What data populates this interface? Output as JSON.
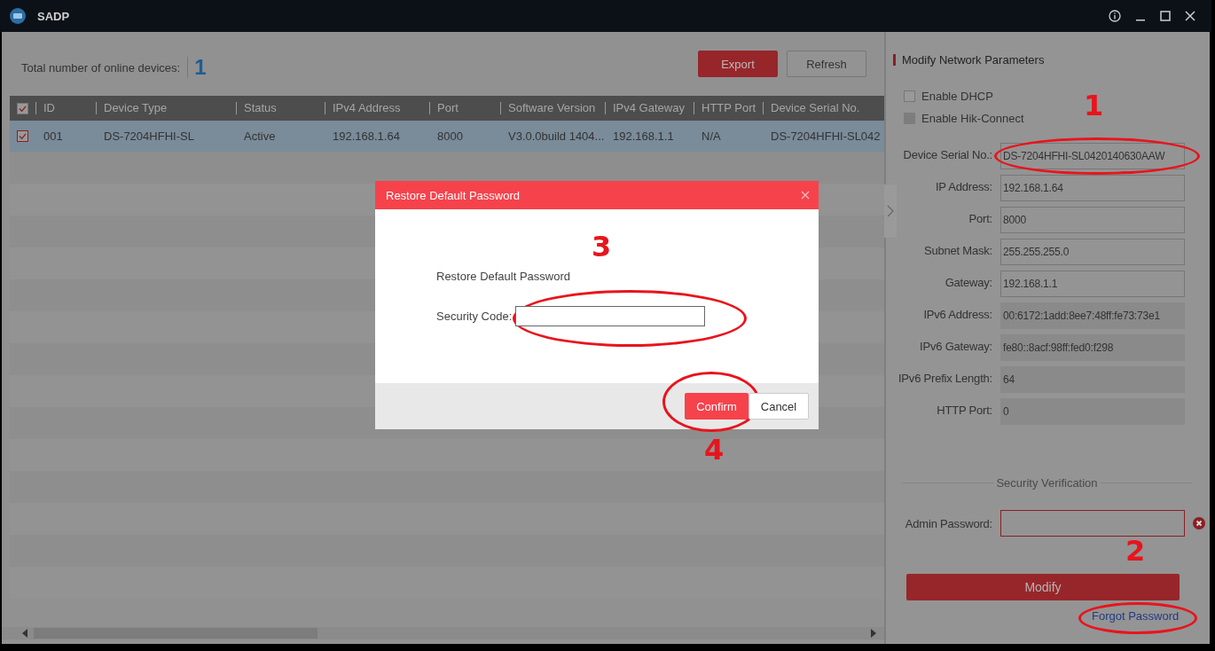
{
  "window": {
    "title": "SADP"
  },
  "device_count": {
    "label": "Total number of online devices:",
    "value": "1"
  },
  "toolbar": {
    "buttons": [
      {
        "label": "Export",
        "kind": "primary"
      },
      {
        "label": "Refresh",
        "kind": "default"
      }
    ]
  },
  "table": {
    "header_checked": true,
    "columns": [
      "ID",
      "Device Type",
      "Status",
      "IPv4 Address",
      "Port",
      "Software Version",
      "IPv4 Gateway",
      "HTTP Port",
      "Device Serial No."
    ],
    "rows": [
      {
        "selected": true,
        "checked": true,
        "cells": [
          "001",
          "DS-7204HFHI-SL",
          "Active",
          "192.168.1.64",
          "8000",
          "V3.0.0build 1404...",
          "192.168.1.1",
          "N/A",
          "DS-7204HFHI-SL042"
        ]
      }
    ]
  },
  "panel": {
    "title": "Modify Network Parameters",
    "options": [
      {
        "label": "Enable DHCP",
        "checked": false,
        "disabled": false
      },
      {
        "label": "Enable Hik-Connect",
        "checked": false,
        "disabled": true
      }
    ],
    "fields": [
      {
        "label": "Device Serial No.:",
        "value": "DS-7204HFHI-SL0420140630AAW",
        "disabled": false,
        "annotation": {
          "number": "1",
          "circled": true
        }
      },
      {
        "label": "IP Address:",
        "value": "192.168.1.64",
        "disabled": false
      },
      {
        "label": "Port:",
        "value": "8000",
        "disabled": false
      },
      {
        "label": "Subnet Mask:",
        "value": "255.255.255.0",
        "disabled": false
      },
      {
        "label": "Gateway:",
        "value": "192.168.1.1",
        "disabled": false
      },
      {
        "label": "IPv6 Address:",
        "value": "00:6172:1add:8ee7:48ff:fe73:73e1",
        "disabled": true
      },
      {
        "label": "IPv6 Gateway:",
        "value": "fe80::8acf:98ff:fed0:f298",
        "disabled": true
      },
      {
        "label": "IPv6 Prefix Length:",
        "value": "64",
        "disabled": true
      },
      {
        "label": "HTTP Port:",
        "value": "0",
        "disabled": true
      }
    ],
    "security": {
      "title": "Security Verification",
      "password_label": "Admin Password:",
      "error": true
    },
    "modify_button": "Modify",
    "forgot_link": {
      "label": "Forgot Password",
      "annotation": {
        "number": "2",
        "circled": true
      }
    }
  },
  "dialog": {
    "title": "Restore Default Password",
    "heading": "Restore Default Password",
    "heading_annotation": {
      "number": "3"
    },
    "field_label": "Security Code:",
    "field_annotation": {
      "circled": true
    },
    "buttons": [
      {
        "label": "Confirm",
        "kind": "primary",
        "annotation": {
          "number": "4",
          "circled": true
        }
      },
      {
        "label": "Cancel",
        "kind": "default"
      }
    ]
  }
}
